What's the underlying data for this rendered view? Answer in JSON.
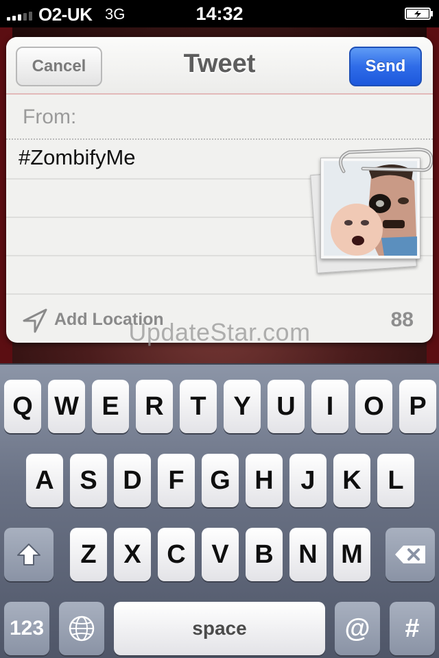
{
  "status_bar": {
    "carrier": "O2-UK",
    "network": "3G",
    "time": "14:32",
    "signal_icon": "signal-bars-icon",
    "battery_icon": "battery-charging-icon"
  },
  "compose_sheet": {
    "title": "Tweet",
    "cancel_label": "Cancel",
    "send_label": "Send",
    "from_label": "From:",
    "tweet_text": "#ZombifyMe",
    "attachment": "attached-photo-zombie-faces",
    "location_icon": "location-arrow-icon",
    "add_location_label": "Add Location",
    "char_count": "88"
  },
  "watermark": "UpdateStar.com",
  "keyboard": {
    "row1": [
      "Q",
      "W",
      "E",
      "R",
      "T",
      "Y",
      "U",
      "I",
      "O",
      "P"
    ],
    "row2": [
      "A",
      "S",
      "D",
      "F",
      "G",
      "H",
      "J",
      "K",
      "L"
    ],
    "row3": [
      "Z",
      "X",
      "C",
      "V",
      "B",
      "N",
      "M"
    ],
    "shift_icon": "shift-arrow-icon",
    "delete_icon": "backspace-icon",
    "numbers_label": "123",
    "globe_icon": "globe-icon",
    "space_label": "space",
    "at_label": "@",
    "hash_label": "#"
  },
  "colors": {
    "send_button": "#2f6ce8",
    "keyboard_background": "#6b7386",
    "sheet_background": "#f1f1ef"
  }
}
